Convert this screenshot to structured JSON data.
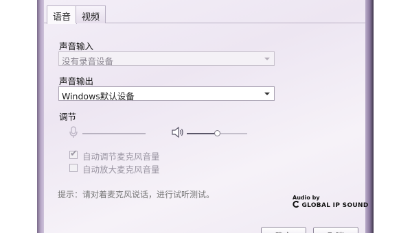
{
  "tabs": [
    {
      "label": "语音",
      "active": true
    },
    {
      "label": "视频",
      "active": false
    }
  ],
  "input": {
    "label": "声音输入",
    "selected": "没有录音设备",
    "disabled": true
  },
  "output": {
    "label": "声音输出",
    "selected": "Windows默认设备"
  },
  "adjust": {
    "label": "调节",
    "mic_icon": "microphone-icon",
    "speaker_icon": "speaker-icon",
    "speaker_volume": 0.5
  },
  "options": [
    {
      "label": "自动调节麦克风音量",
      "checked": true,
      "disabled": true
    },
    {
      "label": "自动放大麦克风音量",
      "checked": false,
      "disabled": true
    }
  ],
  "hint": "提示：请对着麦克风说话，进行试听测试。",
  "brand": {
    "small": "Audio by",
    "main": "GLOBAL IP SOUND"
  },
  "buttons": {
    "ok": "确定",
    "cancel": "取消"
  }
}
